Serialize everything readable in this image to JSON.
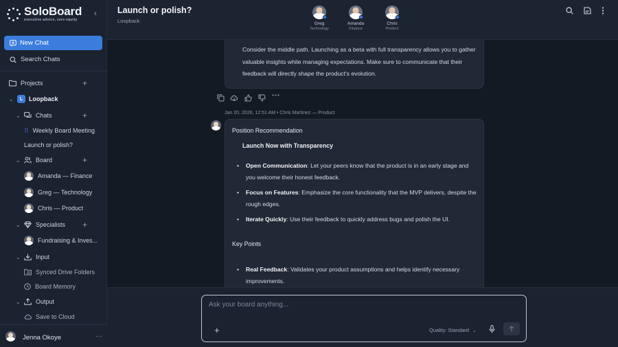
{
  "brand": {
    "name": "SoloBoard",
    "tagline": "executive advice, zero equity"
  },
  "sidebar": {
    "new_chat": "New Chat",
    "search_chats": "Search Chats",
    "projects_label": "Projects",
    "project": {
      "badge": "L",
      "name": "Loopback"
    },
    "chats_label": "Chats",
    "chats": [
      "Weekly Board Meeting",
      "Launch or polish?"
    ],
    "board_label": "Board",
    "board": [
      "Amanda — Finance",
      "Greg — Technology",
      "Chris — Product"
    ],
    "specialists_label": "Specialists",
    "specialists": [
      "Fundraising & Inves..."
    ],
    "input_label": "Input",
    "input_items": [
      "Synced Drive Folders",
      "Board Memory"
    ],
    "output_label": "Output",
    "output_items": [
      "Save to Cloud"
    ],
    "user": {
      "name": "Jenna Okoye",
      "more": "···"
    }
  },
  "header": {
    "title": "Launch or polish?",
    "subtitle": "Loopback",
    "members": [
      {
        "name": "Greg",
        "role": "Technology"
      },
      {
        "name": "Amanda",
        "role": "Finance"
      },
      {
        "name": "Chris",
        "role": "Product"
      }
    ]
  },
  "chat": {
    "prev_message": "Consider the middle path. Launching as a beta with full transparency allows you to gather valuable insights while managing expectations. Make sure to communicate that their feedback will directly shape the product's evolution.",
    "meta": "Jan 20, 2026, 12:51 AM • Chris Martinez — Product",
    "message": {
      "title": "Position Recommendation",
      "heading": "Launch Now with Transparency",
      "bullets": [
        {
          "bold": "Open Communication",
          "text": ": Let your peers know that the product is in an early stage and you welcome their honest feedback."
        },
        {
          "bold": "Focus on Features",
          "text": ": Emphasize the core functionality that the MVP delivers, despite the rough edges."
        },
        {
          "bold": "Iterate Quickly",
          "text": ": Use their feedback to quickly address bugs and polish the UI."
        }
      ],
      "key_points_label": "Key Points",
      "key_points": [
        {
          "bold": "Real Feedback",
          "text": ": Validates your product assumptions and helps identify necessary improvements."
        }
      ]
    }
  },
  "composer": {
    "placeholder": "Ask your board anything...",
    "quality": "Quality: Standard"
  },
  "colors": {
    "accent": "#3b7ddd",
    "sidebar_bg": "#1b2230",
    "main_bg": "#141a24",
    "bubble_bg": "#212936"
  }
}
